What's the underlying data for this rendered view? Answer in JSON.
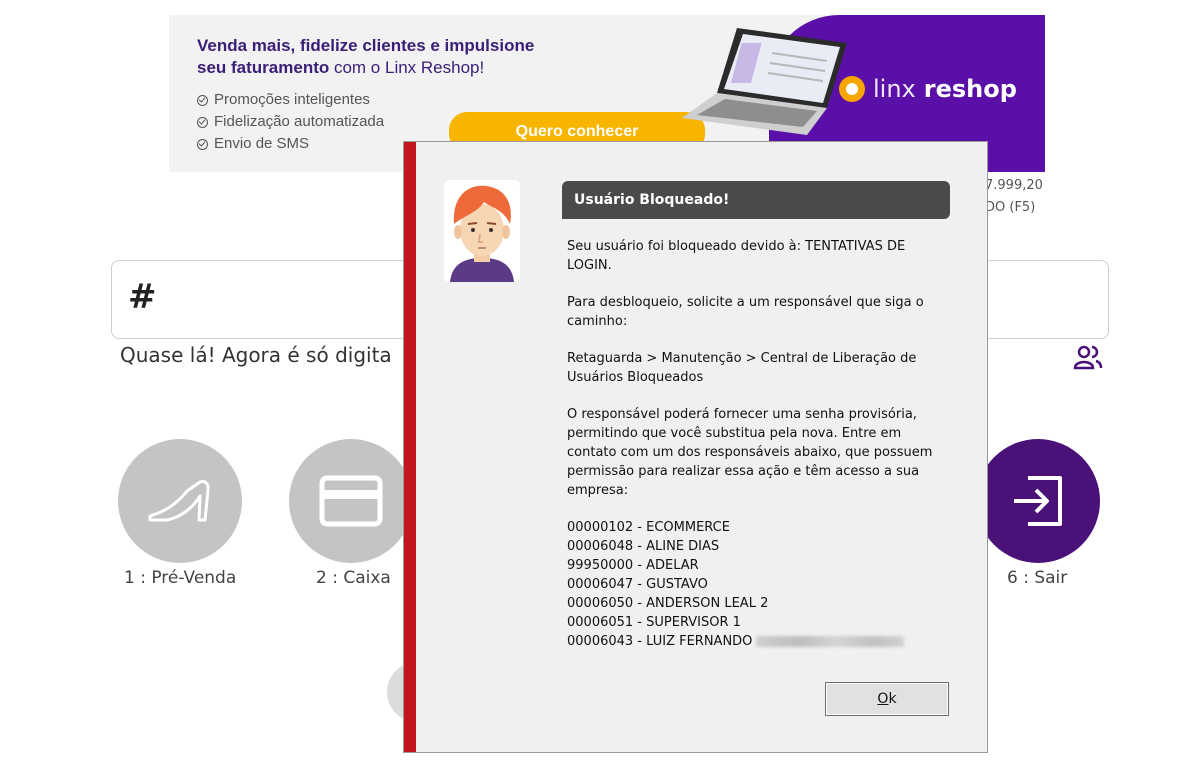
{
  "banner": {
    "headline_bold_1": "Venda mais, fidelize clientes e impulsione",
    "headline_bold_2": "seu faturamento",
    "headline_rest": " com o Linx Reshop!",
    "bullets": [
      "Promoções inteligentes",
      "Fidelização automatizada",
      "Envio de SMS"
    ],
    "cta_label": "Quero conhecer",
    "logo_text_light": "linx",
    "logo_text_bold": "reshop"
  },
  "background": {
    "price_partial": "7.999,20",
    "discount_partial": "DO (F5)",
    "code_input_value": "#",
    "hint_text": "Quase lá! Agora é só digita",
    "tiles": [
      {
        "label": "1 : Pré-Venda",
        "icon": "shoe-icon"
      },
      {
        "label": "2 : Caixa",
        "icon": "card-icon"
      },
      {
        "label": "6 : Sair",
        "icon": "exit-icon"
      }
    ]
  },
  "modal": {
    "title": "Usuário Bloqueado!",
    "paragraphs": [
      "Seu usuário foi bloqueado devido à: TENTATIVAS DE LOGIN.",
      "Para desbloqueio, solicite a um responsável que siga o caminho:",
      "Retaguarda > Manutenção > Central de Liberação de Usuários Bloqueados",
      "O responsável poderá fornecer uma senha provisória, permitindo que você substitua pela nova. Entre em contato com um dos responsáveis abaixo, que possuem permissão para realizar essa ação e têm acesso a sua empresa:"
    ],
    "responsibles": [
      "00000102 - ECOMMERCE",
      "00006048 - ALINE DIAS",
      "99950000 - ADELAR",
      "00006047 - GUSTAVO",
      "00006050 - ANDERSON LEAL 2",
      "00006051 - SUPERVISOR 1",
      "00006043 - LUIZ FERNANDO"
    ],
    "ok_label_underlined": "O",
    "ok_label_rest": "k"
  },
  "colors": {
    "banner_purple": "#5a0fa8",
    "cta_yellow": "#f7b500",
    "modal_stripe": "#c0171c",
    "sair_tile": "#4a1178"
  }
}
